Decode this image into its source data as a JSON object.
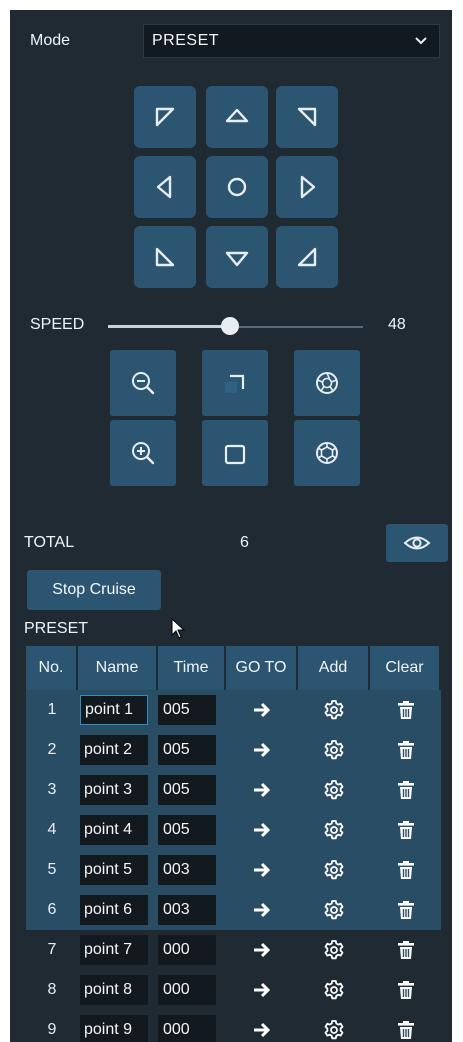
{
  "mode": {
    "label": "Mode",
    "value": "PRESET"
  },
  "speed": {
    "label": "SPEED",
    "value": "48",
    "level_fraction": 0.48
  },
  "total": {
    "label": "TOTAL",
    "value": "6"
  },
  "stop_cruise_label": "Stop Cruise",
  "preset_label": "PRESET",
  "table": {
    "headers": [
      "No.",
      "Name",
      "Time",
      "GO TO",
      "Add",
      "Clear"
    ],
    "rows": [
      {
        "no": "1",
        "name": "point 1",
        "time": "005"
      },
      {
        "no": "2",
        "name": "point 2",
        "time": "005"
      },
      {
        "no": "3",
        "name": "point 3",
        "time": "005"
      },
      {
        "no": "4",
        "name": "point 4",
        "time": "005"
      },
      {
        "no": "5",
        "name": "point 5",
        "time": "003"
      },
      {
        "no": "6",
        "name": "point 6",
        "time": "003"
      },
      {
        "no": "7",
        "name": "point 7",
        "time": "000"
      },
      {
        "no": "8",
        "name": "point 8",
        "time": "000"
      },
      {
        "no": "9",
        "name": "point 9",
        "time": "000"
      }
    ]
  },
  "colors": {
    "panel": "#1f2a33",
    "button": "#2b5570",
    "selected_row": "#2a4d66",
    "field": "#121a20"
  }
}
